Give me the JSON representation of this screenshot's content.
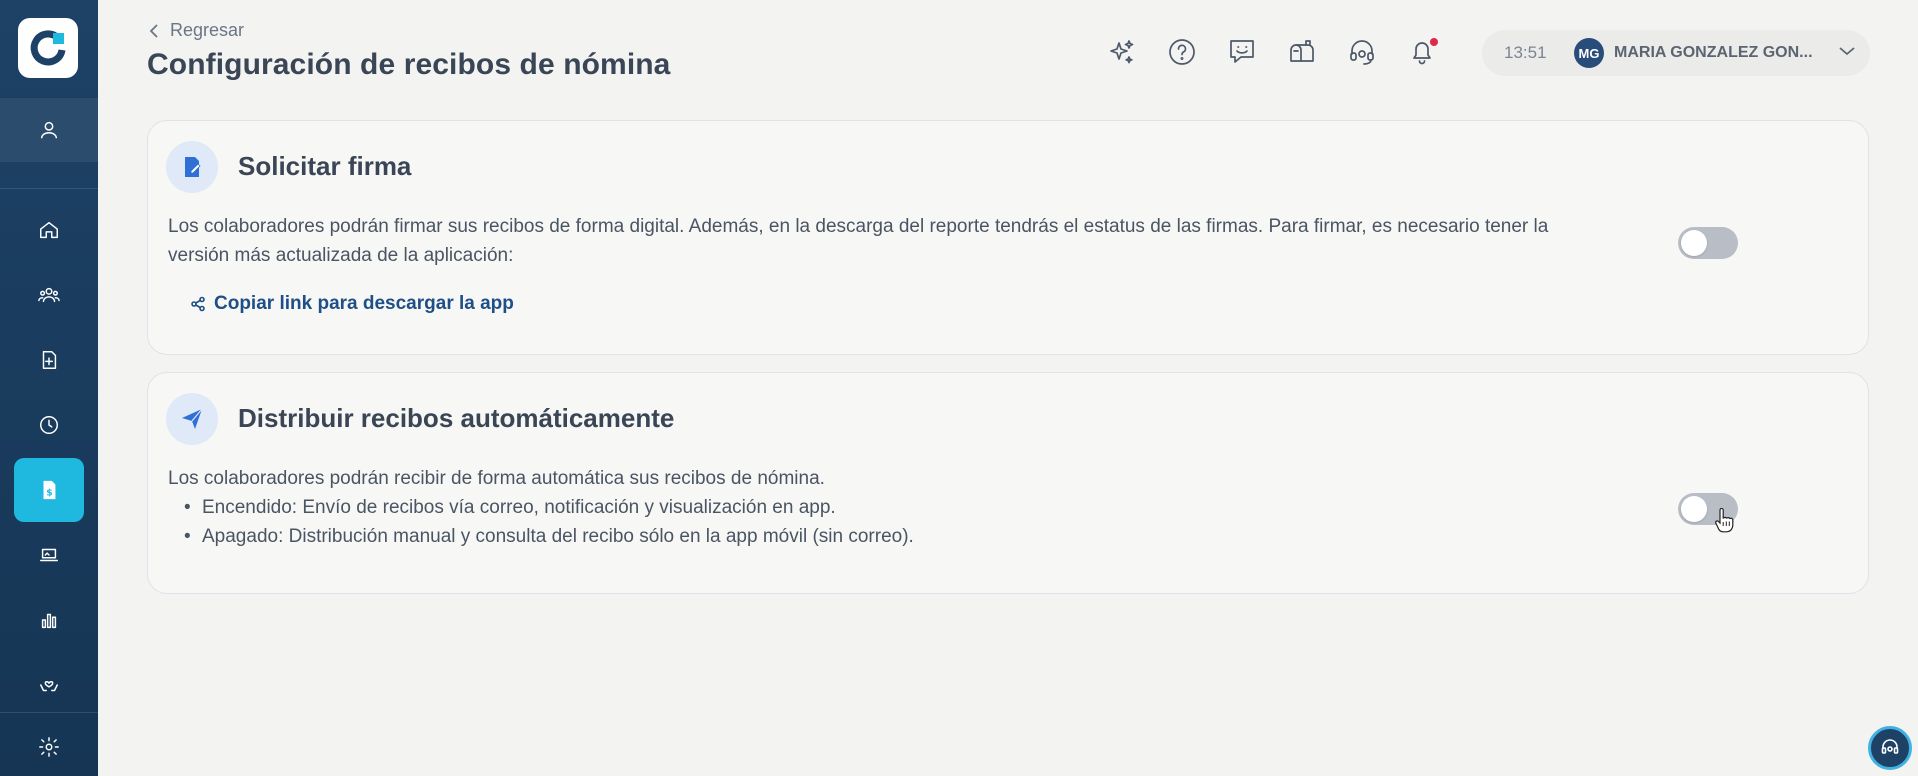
{
  "header": {
    "back_label": "Regresar",
    "title": "Configuración de recibos de nómina",
    "icons": [
      "sparkles-icon",
      "help-circle-icon",
      "feedback-icon",
      "mailbox-icon",
      "support-headset-icon",
      "bell-icon"
    ],
    "time": "13:51",
    "user_initials": "MG",
    "user_name": "MARIA GONZALEZ GON..."
  },
  "sidebar": {
    "items": [
      "user-icon",
      "home-icon",
      "people-icon",
      "document-add-icon",
      "clock-icon",
      "payroll-receipt-icon",
      "laptop-icon",
      "bar-chart-icon",
      "hands-heart-icon",
      "gear-icon"
    ],
    "active": "payroll-receipt-icon",
    "accent_color": "#1fb9e0"
  },
  "cards": {
    "signature": {
      "title": "Solicitar firma",
      "description": "Los colaboradores podrán firmar sus recibos de forma digital. Además, en la descarga del reporte tendrás el estatus de las firmas. Para firmar, es necesario tener la versión más actualizada de la aplicación:",
      "link_label": "Copiar link para descargar la app",
      "toggle_on": false
    },
    "distribution": {
      "title": "Distribuir recibos automáticamente",
      "description": "Los colaboradores podrán recibir de forma automática sus recibos de nómina.",
      "bullets": [
        "Encendido: Envío de recibos vía correo, notificación y visualización en app.",
        "Apagado: Distribución manual y consulta del recibo sólo en la app móvil (sin correo)."
      ],
      "toggle_on": false
    }
  },
  "colors": {
    "brand": "#1d4266",
    "link": "#1e4f86",
    "icon_accent": "#2f6fd6",
    "notification": "#e0284a"
  }
}
